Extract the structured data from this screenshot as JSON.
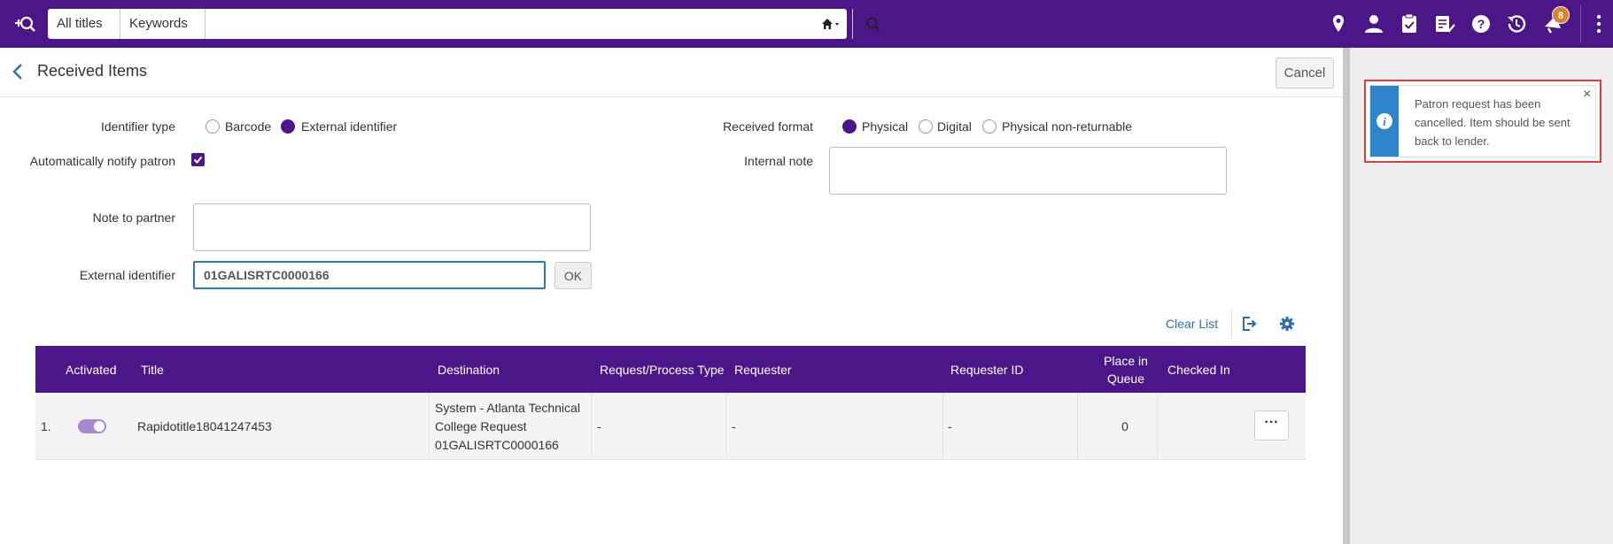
{
  "topbar": {
    "scope_label": "All titles",
    "field_label": "Keywords",
    "search_value": "",
    "notifications_count": "8"
  },
  "header": {
    "title": "Received Items",
    "cancel_label": "Cancel"
  },
  "form": {
    "identifier_type_label": "Identifier type",
    "identifier_options": [
      "Barcode",
      "External identifier"
    ],
    "identifier_selected": "External identifier",
    "auto_notify_label": "Automatically notify patron",
    "auto_notify_checked": true,
    "received_format_label": "Received format",
    "format_options": [
      "Physical",
      "Digital",
      "Physical non-returnable"
    ],
    "format_selected": "Physical",
    "internal_note_label": "Internal note",
    "internal_note_value": "",
    "note_to_partner_label": "Note to partner",
    "note_to_partner_value": "",
    "external_identifier_label": "External identifier",
    "external_identifier_value": "01GALISRTC0000166",
    "ok_label": "OK"
  },
  "list_toolbar": {
    "clear_list_label": "Clear List"
  },
  "table": {
    "columns": [
      "Activated",
      "Title",
      "Destination",
      "Request/Process Type",
      "Requester",
      "Requester ID",
      "Place in Queue",
      "Checked In"
    ],
    "rows": [
      {
        "index": "1.",
        "activated": true,
        "title": "Rapidotitle18041247453",
        "destination_line1": "System - Atlanta Technical",
        "destination_line2": "College Request",
        "destination_line3": "01GALISRTC0000166",
        "request_type": "-",
        "requester": "-",
        "requester_id": "-",
        "place_in_queue": "0",
        "checked_in": "",
        "more_label": "···"
      }
    ]
  },
  "notification": {
    "message": "Patron request has been cancelled. Item should be sent back to lender.",
    "close_label": "×"
  },
  "colors": {
    "brand": "#4b1688",
    "link": "#2c6fb0",
    "info": "#2e85c9",
    "highlight": "#e03c3c",
    "badge": "#d9822b"
  }
}
